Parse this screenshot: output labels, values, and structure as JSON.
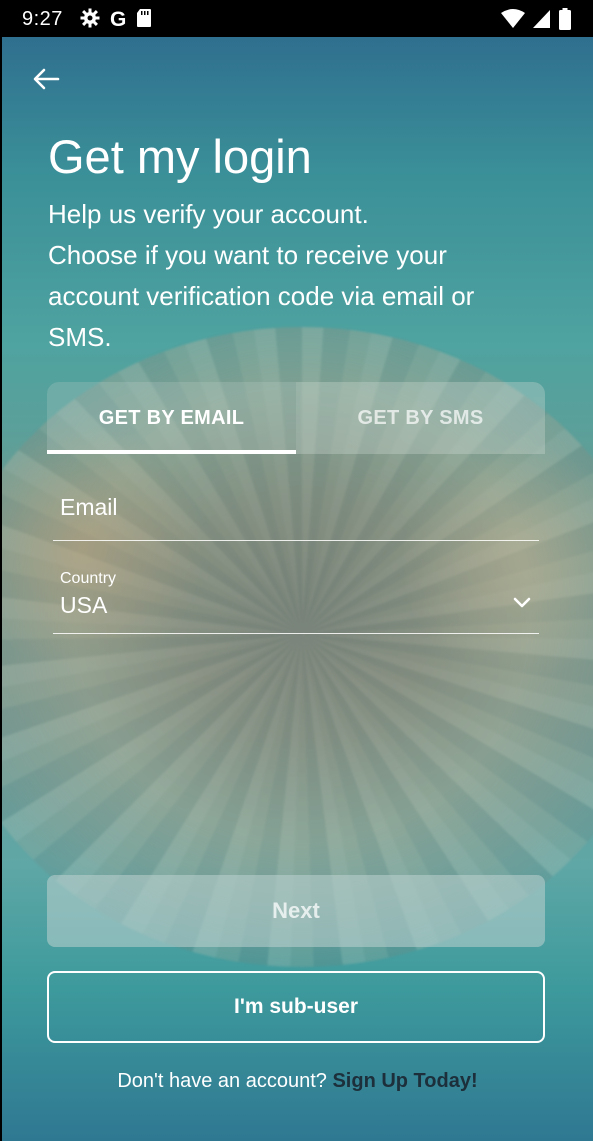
{
  "status_bar": {
    "time": "9:27",
    "left_icons": [
      "settings-gear-icon",
      "google-g-icon",
      "sd-card-icon"
    ],
    "right_icons": [
      "wifi-icon",
      "cell-signal-icon",
      "battery-icon"
    ],
    "google_letter": "G"
  },
  "header": {
    "back_icon": "arrow-left-icon"
  },
  "page": {
    "title": "Get my login",
    "subtitle_line1": "Help us verify your account.",
    "subtitle_line2": "Choose if you want to receive your account verification code via email or SMS."
  },
  "tabs": [
    {
      "label": "GET BY EMAIL",
      "active": true
    },
    {
      "label": "GET BY SMS",
      "active": false
    }
  ],
  "form": {
    "email_placeholder": "Email",
    "email_value": "",
    "country_label": "Country",
    "country_value": "USA",
    "country_icon": "chevron-down-icon"
  },
  "buttons": {
    "next_label": "Next",
    "next_enabled": false,
    "subuser_label": "I'm sub-user"
  },
  "footer": {
    "prompt": "Don't have an account?",
    "link": "Sign Up Today!"
  },
  "colors": {
    "link": "#1c2f3a",
    "text": "#ffffff"
  }
}
